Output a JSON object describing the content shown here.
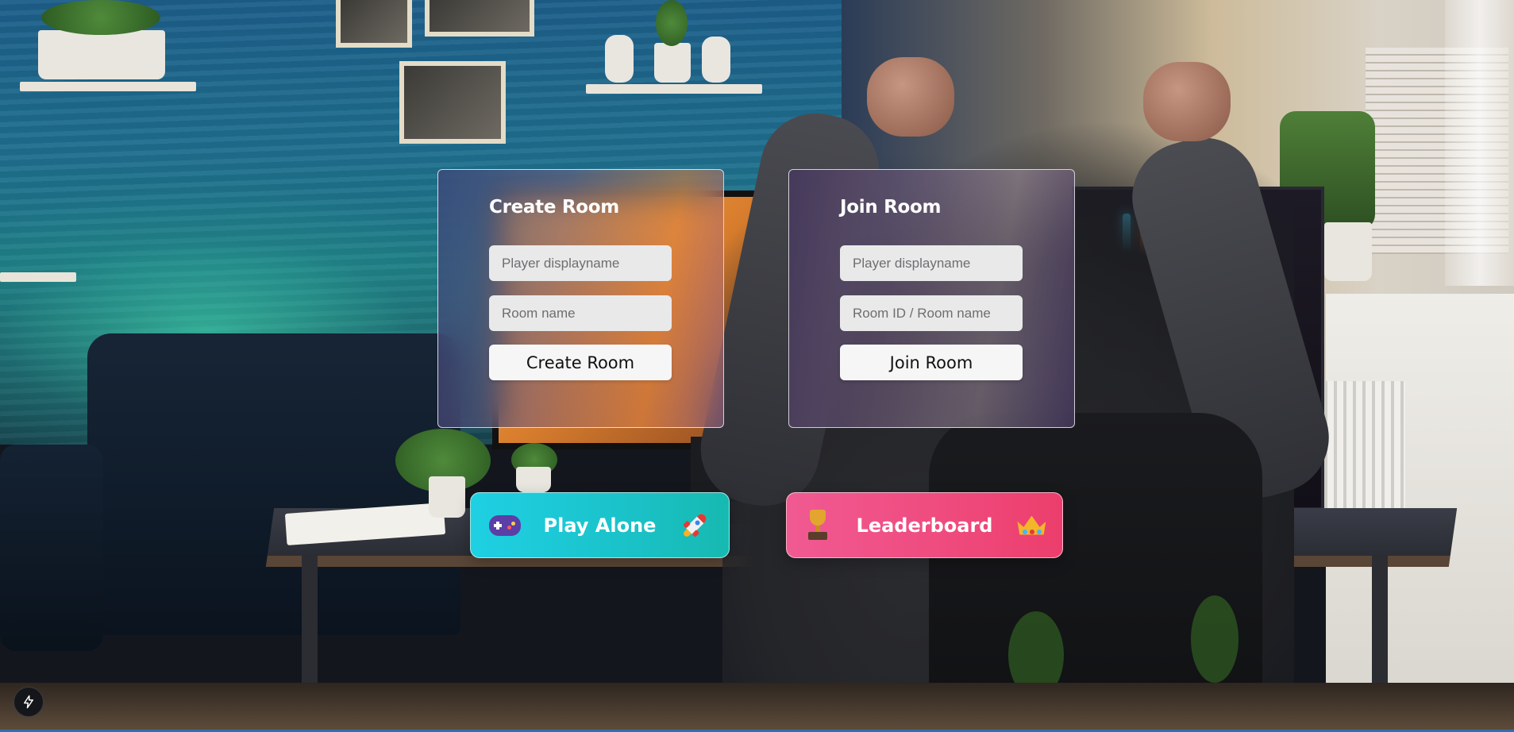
{
  "create_room": {
    "title": "Create Room",
    "player_placeholder": "Player displayname",
    "room_placeholder": "Room name",
    "button_label": "Create Room"
  },
  "join_room": {
    "title": "Join Room",
    "player_placeholder": "Player displayname",
    "room_placeholder": "Room ID / Room name",
    "button_label": "Join Room"
  },
  "actions": {
    "play_alone": {
      "label": "Play Alone",
      "icon_left": "gamepad-icon",
      "icon_right": "rocket-icon",
      "colors": [
        "#1fd0e3",
        "#17b9b0"
      ]
    },
    "leaderboard": {
      "label": "Leaderboard",
      "icon_left": "trophy-icon",
      "icon_right": "crown-icon",
      "colors": [
        "#f05a92",
        "#ec3e6c"
      ]
    }
  },
  "corner_badge_icon": "lightning-icon"
}
